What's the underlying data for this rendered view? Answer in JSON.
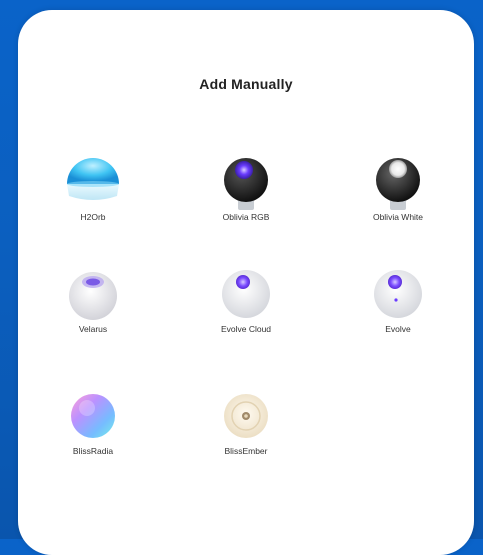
{
  "dialog": {
    "title": "Add Manually"
  },
  "devices": [
    {
      "name": "H2Orb",
      "icon": "h2orb-device-icon"
    },
    {
      "name": "Oblivia RGB",
      "icon": "oblivia-rgb-device-icon"
    },
    {
      "name": "Oblivia White",
      "icon": "oblivia-white-device-icon"
    },
    {
      "name": "Velarus",
      "icon": "velarus-device-icon"
    },
    {
      "name": "Evolve Cloud",
      "icon": "evolve-cloud-device-icon"
    },
    {
      "name": "Evolve",
      "icon": "evolve-device-icon"
    },
    {
      "name": "BlissRadia",
      "icon": "blissradia-device-icon"
    },
    {
      "name": "BlissEmber",
      "icon": "blissember-device-icon"
    }
  ],
  "colors": {
    "background": "#0a5fbf",
    "sheet": "#ffffff",
    "accent_purple": "#6a3cff",
    "h2orb_blue": "#28b6f0"
  }
}
